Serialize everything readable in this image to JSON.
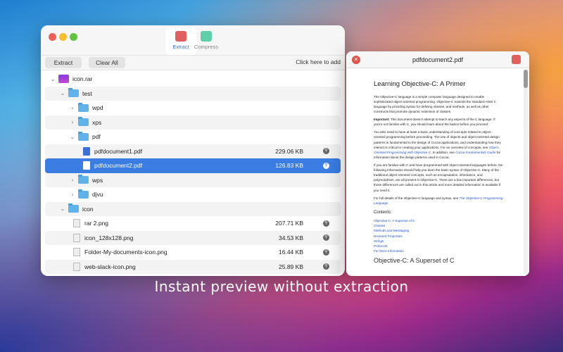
{
  "tabs": [
    {
      "label": "Extract"
    },
    {
      "label": "Compress"
    }
  ],
  "toolbar": {
    "extract": "Extract",
    "clear_all": "Clear All",
    "add_hint": "Click here to add"
  },
  "tree": [
    {
      "name": "icon.rar",
      "type": "rar",
      "depth": 0,
      "open": true
    },
    {
      "name": "test",
      "type": "folder",
      "depth": 1,
      "open": true
    },
    {
      "name": "wpd",
      "type": "folder",
      "depth": 2,
      "open": false
    },
    {
      "name": "xps",
      "type": "folder",
      "depth": 2,
      "open": false
    },
    {
      "name": "pdf",
      "type": "folder",
      "depth": 2,
      "open": true
    },
    {
      "name": "pdfdocument1.pdf",
      "type": "pdf",
      "depth": 3,
      "size": "229.06 KB"
    },
    {
      "name": "pdfdocument2.pdf",
      "type": "pdf",
      "depth": 3,
      "size": "126.83 KB",
      "selected": true
    },
    {
      "name": "wps",
      "type": "folder",
      "depth": 2,
      "open": false
    },
    {
      "name": "djvu",
      "type": "folder",
      "depth": 2,
      "open": false
    },
    {
      "name": "icon",
      "type": "folder",
      "depth": 1,
      "open": true
    },
    {
      "name": "rar 2.png",
      "type": "file",
      "depth": 2,
      "size": "207.71 KB"
    },
    {
      "name": "icon_128x128.png",
      "type": "file",
      "depth": 2,
      "size": "34.53 KB"
    },
    {
      "name": "Folder-My-documents-icon.png",
      "type": "file",
      "depth": 2,
      "size": "16.44 KB"
    },
    {
      "name": "web-slack-icon.png",
      "type": "file",
      "depth": 2,
      "size": "25.89 KB"
    }
  ],
  "preview": {
    "title": "pdfdocument2.pdf",
    "heading": "Learning Objective-C: A Primer",
    "p1": "The Objective-C language is a simple computer language designed to enable sophisticated object-oriented programming. Objective-C extends the standard ANSI C language by providing syntax for defining classes, and methods, as well as other constructs that promote dynamic extension of classes.",
    "p2_bold": "Important:",
    "p2": " This document doesn't attempt to teach any aspects of the C language. If you're not familiar with C, you should learn about the basics before you proceed.",
    "p3a": "You also need to have at least a basic understanding of concepts related to object-oriented programming before proceeding. The use of objects and object-oriented design patterns is fundamental to the design of Cocoa applications, and understanding how they interact is critical to creating your applications. For an overview of concepts, see ",
    "p3link1": "Object-Oriented Programming with Objective-C",
    "p3b": ". In addition, see ",
    "p3link2": "Cocoa Fundamentals Guide",
    "p3c": " for information about the design patterns used in Cocoa.",
    "p4": "If you are familiar with C and have programmed with object-oriented languages before, the following information should help you learn the basic syntax of Objective-C. Many of the traditional object-oriented concepts, such as encapsulation, inheritance, and polymorphism, are all present in Objective-C. There are a few important differences, but those differences are called out in this article and more detailed information is available if you need it.",
    "p5": "For full details of the Objective-C language and syntax, see ",
    "p5link": "The Objective-C Programming Language",
    "contents_label": "Contents:",
    "contents": [
      "Objective-C: A Superset of C",
      "Classes",
      "Methods and Messaging",
      "Declared Properties",
      "Strings",
      "Protocols",
      "For More Information"
    ],
    "next_heading": "Objective-C: A Superset of C"
  },
  "caption": "Instant preview without extraction"
}
